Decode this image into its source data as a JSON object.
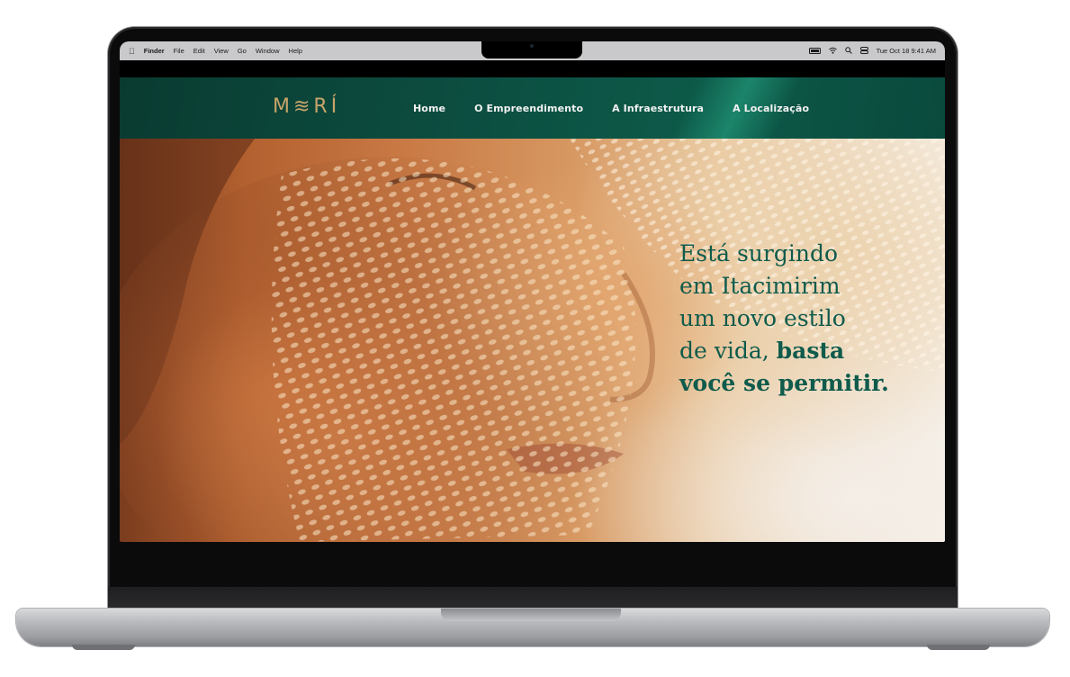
{
  "menubar": {
    "apple_icon": "apple-icon",
    "app_name": "Finder",
    "menus": [
      "File",
      "Edit",
      "View",
      "Go",
      "Window",
      "Help"
    ],
    "datetime": "Tue Oct 18  9:41 AM"
  },
  "site": {
    "logo": "M≋RÍ",
    "nav": [
      "Home",
      "O Empreendimento",
      "A Infraestrutura",
      "A Localização"
    ],
    "hero": {
      "line1": "Está surgindo",
      "line2": "em Itacimirim",
      "line3": "um novo estilo",
      "line4_plain": "de vida, ",
      "line4_bold": "basta",
      "line5_bold": "você se permitir."
    }
  },
  "colors": {
    "brand_green": "#0c4d40",
    "logo_gold": "#c7a46a",
    "hero_text": "#0f5b4c"
  }
}
